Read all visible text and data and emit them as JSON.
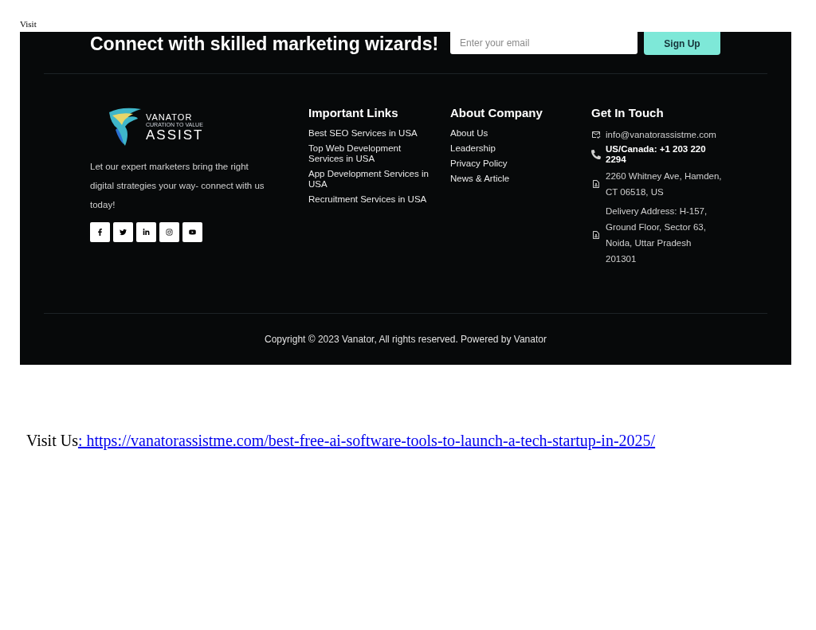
{
  "page_label": "Visit",
  "footer": {
    "heading": "Connect with skilled marketing wizards!",
    "newsletter": {
      "placeholder": "Enter your email",
      "button": "Sign Up"
    },
    "logo": {
      "name": "VANATOR",
      "tagline": "CURATION TO VALUE",
      "product": "ASSIST"
    },
    "about_text": "Let our expert marketers bring the right digital strategies your way- connect with us today!",
    "social": [
      {
        "kind": "facebook"
      },
      {
        "kind": "twitter"
      },
      {
        "kind": "linkedin"
      },
      {
        "kind": "instagram"
      },
      {
        "kind": "youtube"
      }
    ],
    "columns": [
      {
        "title": "Important Links",
        "links": [
          "Best SEO Services in USA",
          "Top Web Development Services in USA",
          "App Development Services in USA",
          "Recruitment Services in USA"
        ]
      },
      {
        "title": "About Company",
        "links": [
          "About Us",
          "Leadership",
          "Privacy Policy",
          "News & Article"
        ]
      }
    ],
    "contact": {
      "title": "Get In Touch",
      "items": [
        {
          "kind": "email",
          "text": "info@vanatorassistme.com"
        },
        {
          "kind": "phone",
          "text": "US/Canada: +1 203 220 2294"
        },
        {
          "kind": "address",
          "text": "2260 Whitney Ave, Hamden, CT 06518, US"
        },
        {
          "kind": "address",
          "text": "Delivery Address: H-157, Ground Floor, Sector 63, Noida, Uttar Pradesh 201301"
        }
      ]
    },
    "copyright": "Copyright © 2023 Vanator, All rights reserved. Powered by Vanator"
  },
  "visit": {
    "label": "Visit Us",
    "link": ": https://vanatorassistme.com/best-free-ai-software-tools-to-launch-a-tech-startup-in-2025/"
  }
}
